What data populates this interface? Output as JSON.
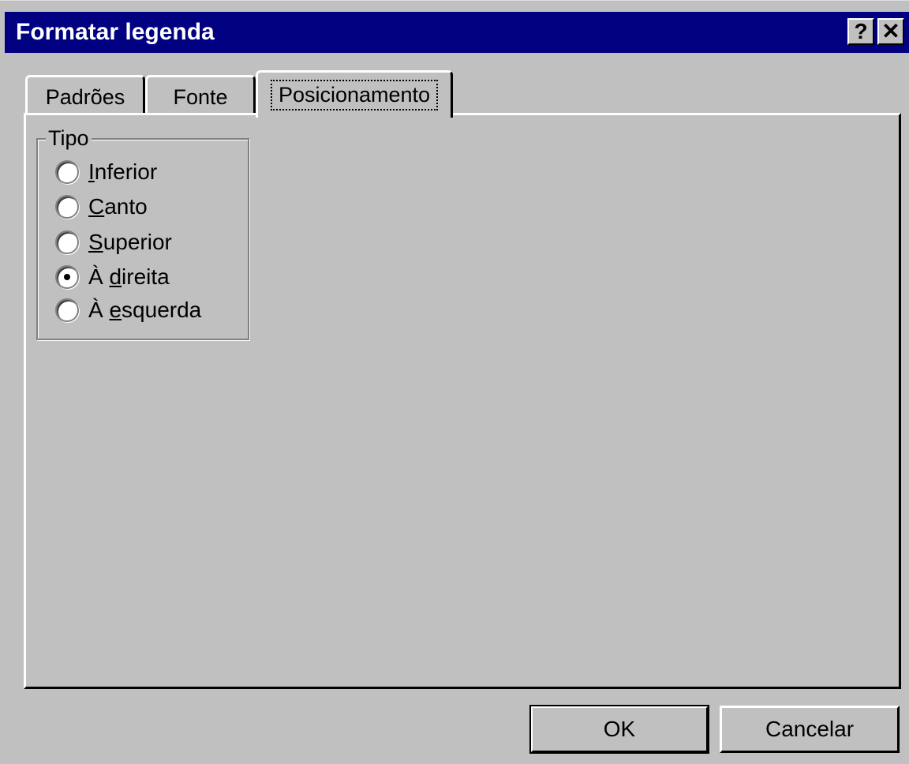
{
  "window": {
    "title": "Formatar legenda"
  },
  "title_buttons": {
    "help": "?",
    "close": "✕"
  },
  "tabs": [
    {
      "label": "Padrões"
    },
    {
      "label": "Fonte"
    },
    {
      "label": "Posicionamento",
      "active": true
    }
  ],
  "group": {
    "label": "Tipo",
    "options": [
      {
        "underline": "I",
        "rest": "nferior",
        "selected": false
      },
      {
        "underline": "C",
        "rest": "anto",
        "selected": false
      },
      {
        "underline": "S",
        "rest": "uperior",
        "selected": false
      },
      {
        "prefix": "À ",
        "underline": "d",
        "rest": "ireita",
        "selected": true
      },
      {
        "prefix": "À ",
        "underline": "e",
        "rest": "squerda",
        "selected": false
      }
    ]
  },
  "buttons": {
    "ok": "OK",
    "cancel": "Cancelar"
  },
  "colors": {
    "titlebar": "#000080",
    "face": "#c0c0c0"
  }
}
